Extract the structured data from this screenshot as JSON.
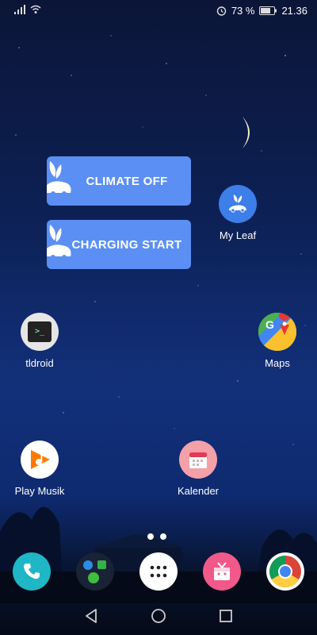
{
  "status": {
    "battery_percent": "73 %",
    "time": "21.36"
  },
  "widgets": [
    {
      "label": "CLIMATE OFF"
    },
    {
      "label": "CHARGING START"
    }
  ],
  "apps": {
    "my_leaf": {
      "label": "My Leaf"
    },
    "tldroid": {
      "label": "tldroid"
    },
    "maps": {
      "label": "Maps"
    },
    "play_musik": {
      "label": "Play Musik"
    },
    "kalender": {
      "label": "Kalender"
    }
  },
  "dock": [
    {
      "icon": "phone-icon"
    },
    {
      "icon": "messaging-folder-icon"
    },
    {
      "icon": "app-drawer-icon"
    },
    {
      "icon": "gift-icon"
    },
    {
      "icon": "chrome-icon"
    }
  ],
  "colors": {
    "widget_blue": "#5b8ff3",
    "leaf_blue": "#3d7ee8",
    "phone_teal": "#1fb7c6",
    "gift_pink": "#f0598a"
  },
  "page_indicator": {
    "pages": 2,
    "current": 1
  },
  "nav": [
    "back-icon",
    "home-icon",
    "recents-icon"
  ]
}
